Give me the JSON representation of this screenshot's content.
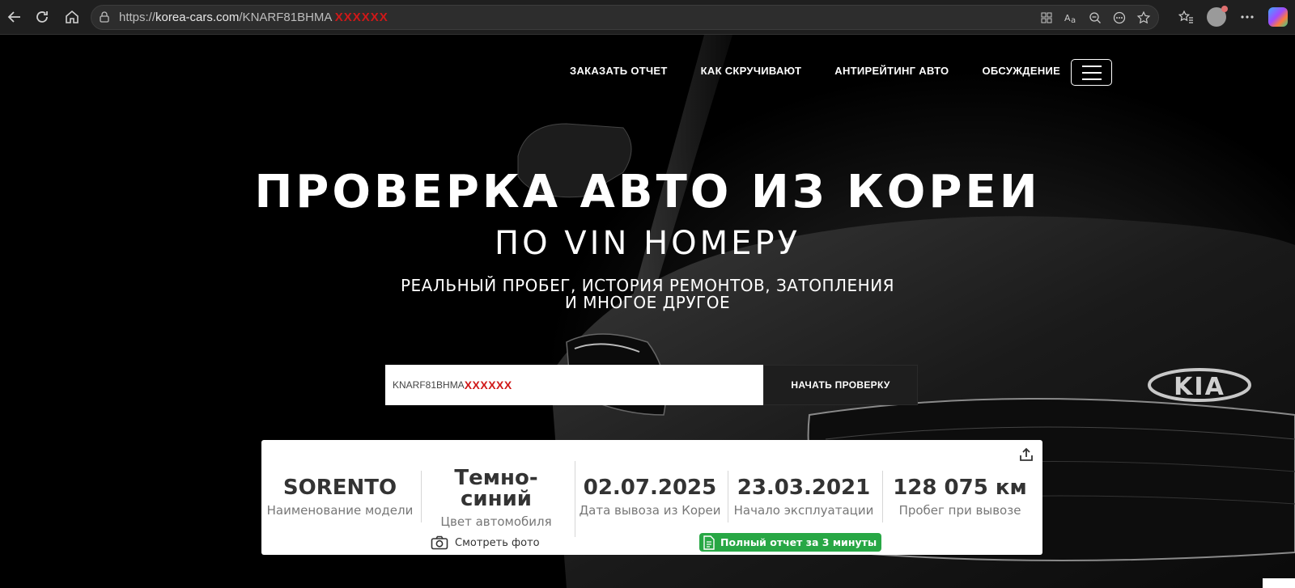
{
  "browser": {
    "url_prefix": "https://",
    "url_domain": "korea-cars.com",
    "url_path": "/KNARF81BHMA",
    "url_redacted": "XXXXXX"
  },
  "nav": {
    "items": [
      "ЗАКАЗАТЬ ОТЧЕТ",
      "КАК СКРУЧИВАЮТ",
      "АНТИРЕЙТИНГ АВТО",
      "ОБСУЖДЕНИЕ"
    ]
  },
  "hero": {
    "title": "ПРОВЕРКА АВТО ИЗ КОРЕИ",
    "subtitle": "ПО VIN НОМЕРУ",
    "tagline_line1": "РЕАЛЬНЫЙ ПРОБЕГ, ИСТОРИЯ РЕМОНТОВ, ЗАТОПЛЕНИЯ",
    "tagline_line2": "И МНОГОЕ ДРУГОЕ"
  },
  "search": {
    "vin_value": "KNARF81BHMA",
    "vin_redacted": "XXXXXX",
    "button_label": "НАЧАТЬ ПРОВЕРКУ"
  },
  "card": {
    "stats": [
      {
        "value": "SORENTO",
        "label": "Наименование модели"
      },
      {
        "value": "Темно-синий",
        "label": "Цвет автомобиля"
      },
      {
        "value": "02.07.2025",
        "label": "Дата вывоза из Кореи"
      },
      {
        "value": "23.03.2021",
        "label": "Начало эксплуатации"
      },
      {
        "value": "128 075 км",
        "label": "Пробег при вывозе"
      }
    ],
    "photo_link": "Смотреть фото",
    "report_badge": "Полный отчет за 3 минуты"
  },
  "brand": {
    "emblem_text": "KIA"
  },
  "colors": {
    "accent_green": "#28a745",
    "redaction_red": "#d01818",
    "background": "#000000"
  }
}
